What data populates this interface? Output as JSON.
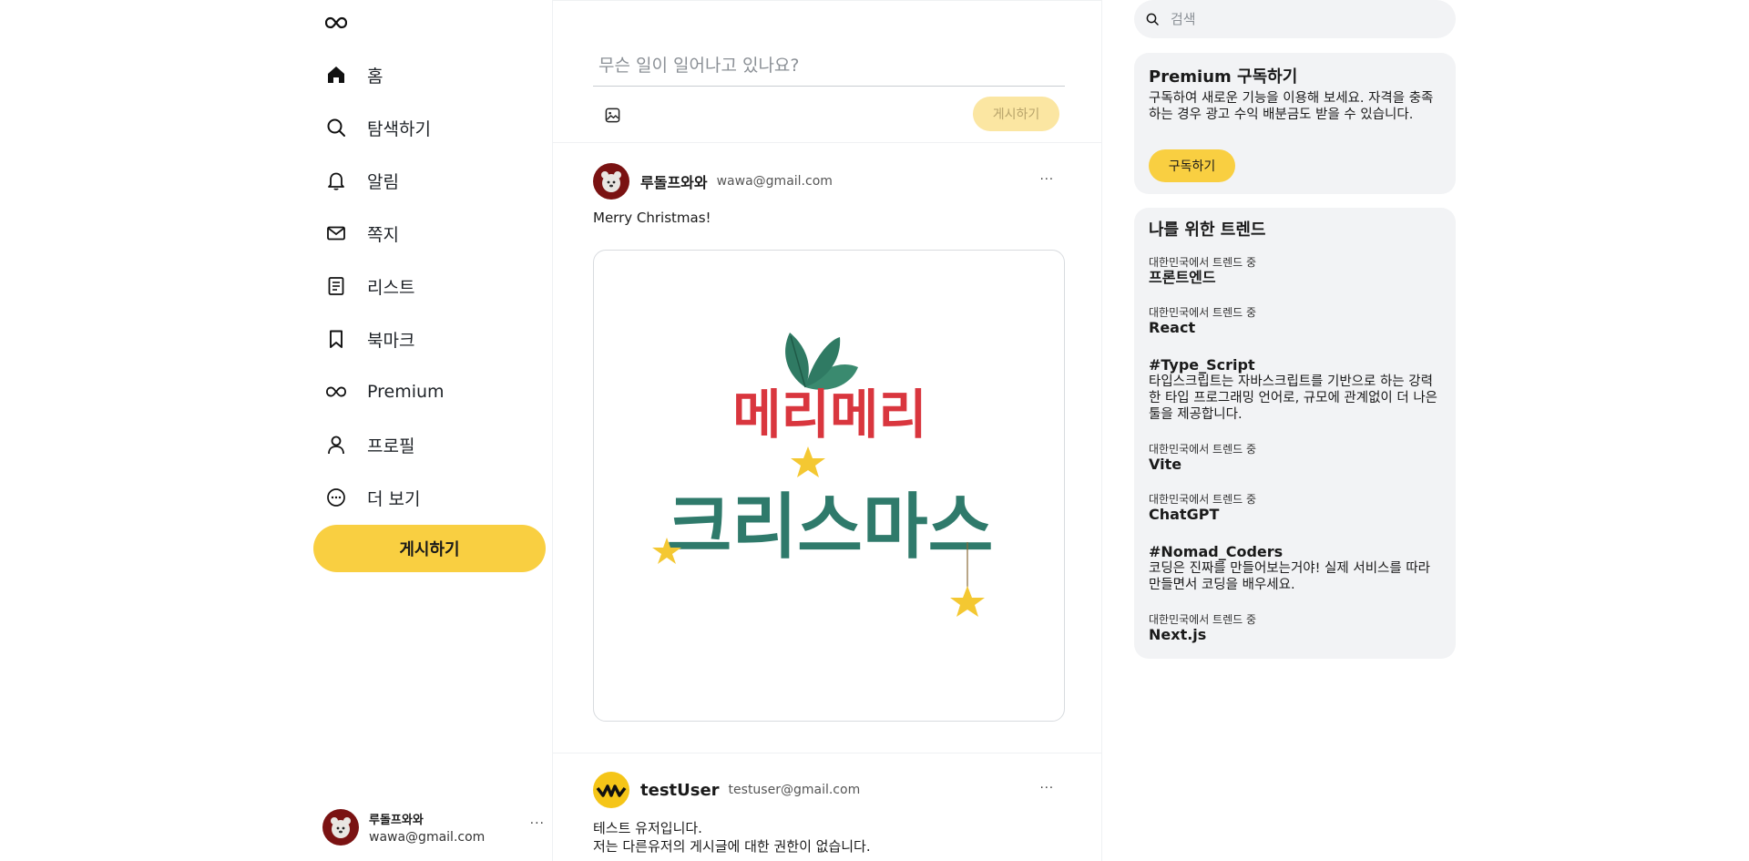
{
  "sidebar": {
    "nav": [
      {
        "label": "홈",
        "icon": "home-icon"
      },
      {
        "label": "탐색하기",
        "icon": "search-icon"
      },
      {
        "label": "알림",
        "icon": "bell-icon"
      },
      {
        "label": "쪽지",
        "icon": "mail-icon"
      },
      {
        "label": "리스트",
        "icon": "list-icon"
      },
      {
        "label": "북마크",
        "icon": "bookmark-icon"
      },
      {
        "label": "Premium",
        "icon": "premium-icon"
      },
      {
        "label": "프로필",
        "icon": "profile-icon"
      },
      {
        "label": "더 보기",
        "icon": "more-circle-icon"
      }
    ],
    "post_button": "게시하기",
    "account": {
      "name": "루돌프와와",
      "email": "wawa@gmail.com",
      "more": "···"
    }
  },
  "compose": {
    "placeholder": "무슨 일이 일어나고 있나요?",
    "post_button": "게시하기"
  },
  "feed": [
    {
      "name": "루돌프와와",
      "email": "wawa@gmail.com",
      "text": "Merry Christmas!",
      "more": "···",
      "image_text_line1": "메리메리",
      "image_text_line2": "크리스마스"
    },
    {
      "name": "testUser",
      "email": "testuser@gmail.com",
      "text_line1": "테스트 유저입니다.",
      "text_line2": "저는 다른유저의 게시글에 대한 권한이 없습니다.",
      "more": "···"
    }
  ],
  "right": {
    "search_placeholder": "검색",
    "premium": {
      "title": "Premium 구독하기",
      "description": "구독하여 새로운 기능을 이용해 보세요. 자격을 충족하는 경우 광고 수익 배분금도 받을 수 있습니다.",
      "button": "구독하기"
    },
    "trends": {
      "title": "나를 위한 트렌드",
      "items": [
        {
          "context": "대한민국에서 트렌드 중",
          "name": "프론트엔드"
        },
        {
          "context": "대한민국에서 트렌드 중",
          "name": "React"
        },
        {
          "name": "#Type_Script",
          "description": "타입스크립트는 자바스크립트를 기반으로 하는 강력한 타입 프로그래밍 언어로, 규모에 관계없이 더 나은 툴을 제공합니다."
        },
        {
          "context": "대한민국에서 트렌드 중",
          "name": "Vite"
        },
        {
          "context": "대한민국에서 트렌드 중",
          "name": "ChatGPT"
        },
        {
          "name": "#Nomad_Coders",
          "description": "코딩은 진짜를 만들어보는거야! 실제 서비스를 따라 만들면서 코딩을 배우세요."
        },
        {
          "context": "대한민국에서 트렌드 중",
          "name": "Next.js"
        }
      ]
    }
  },
  "colors": {
    "accent": "#f9cf41",
    "accent_disabled": "#fbe6a2",
    "card_bg": "#f2f3f5"
  }
}
